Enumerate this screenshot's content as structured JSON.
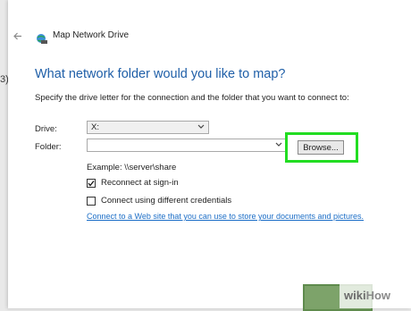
{
  "background": {
    "left_char": "3)"
  },
  "window": {
    "title": "Map Network Drive"
  },
  "wizard": {
    "heading": "What network folder would you like to map?",
    "instruction": "Specify the drive letter for the connection and the folder that you want to connect to:",
    "drive": {
      "label": "Drive:",
      "value": "X:"
    },
    "folder": {
      "label": "Folder:",
      "value": ""
    },
    "browse_label": "Browse...",
    "example": "Example: \\\\server\\share",
    "reconnect": {
      "label": "Reconnect at sign-in",
      "checked": true
    },
    "credentials": {
      "label": "Connect using different credentials",
      "checked": false
    },
    "link": "Connect to a Web site that you can use to store your documents and pictures."
  },
  "watermark": {
    "brand_prefix": "wiki",
    "brand_suffix": "How"
  },
  "colors": {
    "highlight": "#22dd22",
    "heading": "#1f5fa8",
    "link": "#1c6ec7"
  },
  "icons": [
    "back-arrow-icon",
    "network-drive-icon",
    "chevron-down-icon",
    "checkmark-icon"
  ]
}
